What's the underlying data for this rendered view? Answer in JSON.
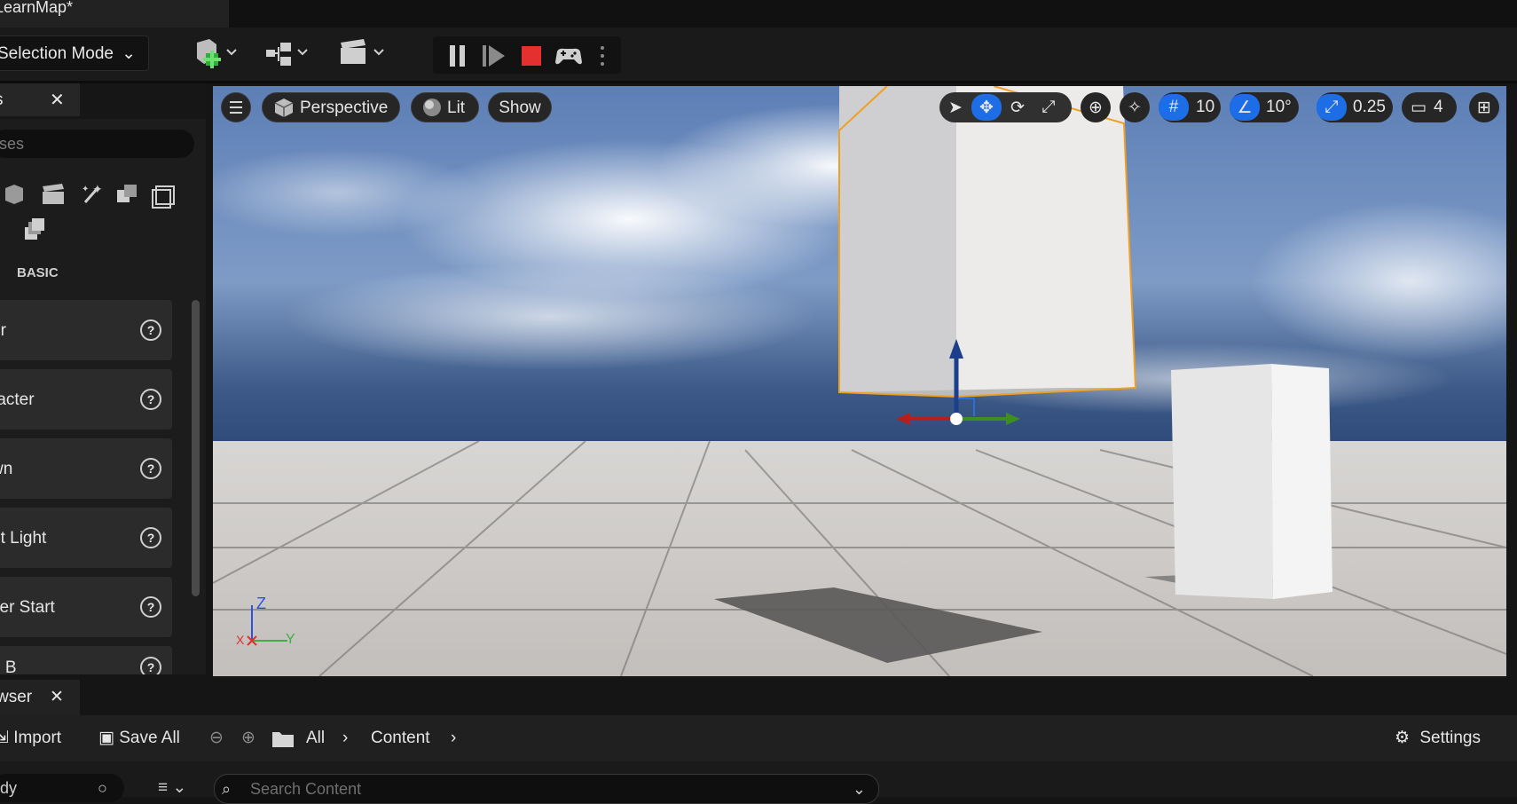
{
  "title_bar": {
    "document_tab": "LearnMap*"
  },
  "toolbar": {
    "selection_mode": "Selection Mode"
  },
  "place_actors": {
    "tab_label": "s",
    "search_placeholder": "sses",
    "category": "BASIC",
    "items": [
      {
        "label": "or"
      },
      {
        "label": "racter"
      },
      {
        "label": "wn"
      },
      {
        "label": "nt Light"
      },
      {
        "label": "yer Start"
      },
      {
        "label": "e B"
      }
    ]
  },
  "viewport": {
    "view_mode": "Perspective",
    "lighting": "Lit",
    "show": "Show",
    "grid_snap": "10",
    "rotation_snap": "10°",
    "scale_snap": "0.25",
    "camera_speed": "4",
    "axis_z": "Z",
    "axis_x": "X",
    "axis_y": "Y"
  },
  "content_browser": {
    "tab_label": "wser",
    "import": "Import",
    "save_all": "Save All",
    "path_all": "All",
    "path_content": "Content",
    "settings": "Settings",
    "search_placeholder": "Search Content",
    "left_search_value": "udy"
  },
  "colors": {
    "selection_outline": "#f0a020",
    "accent_blue": "#1d6ee6",
    "stop_red": "#e53030"
  }
}
